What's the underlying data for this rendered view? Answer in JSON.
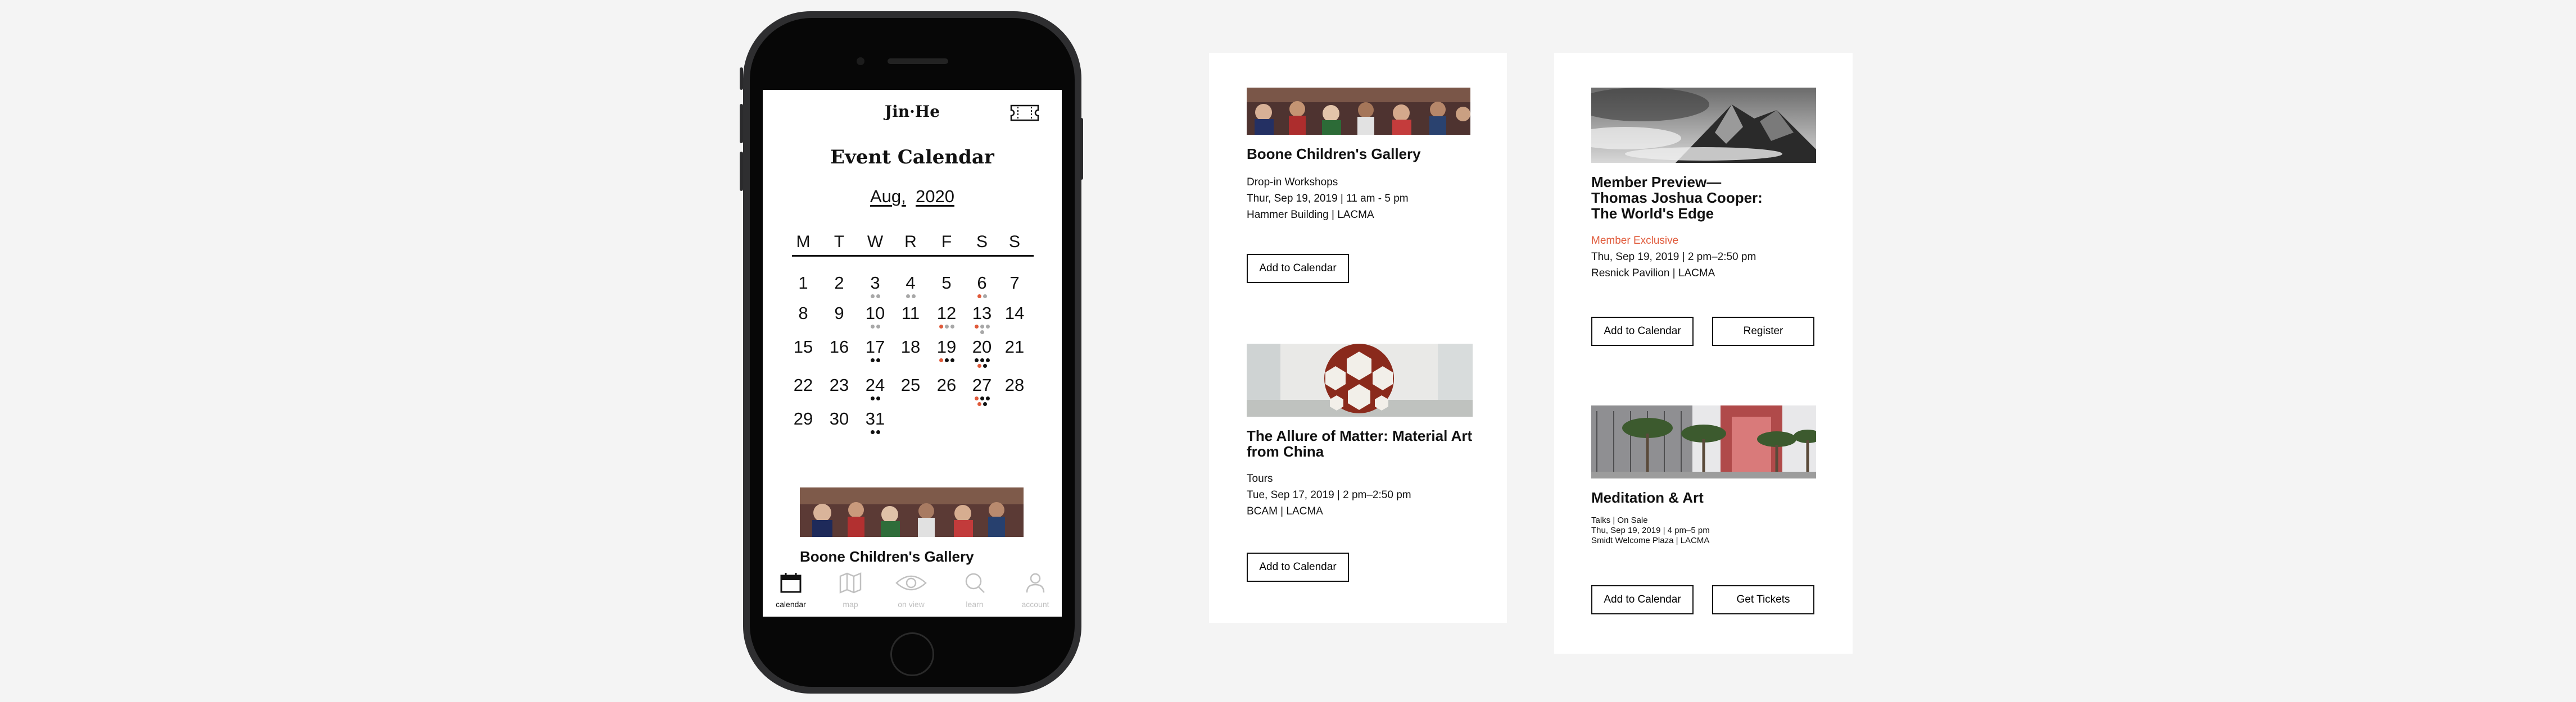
{
  "app": {
    "brand": "Jin·He",
    "title": "Event Calendar",
    "month": "Aug,",
    "year": "2020"
  },
  "weekdays": [
    "M",
    "T",
    "W",
    "R",
    "F",
    "S",
    "S"
  ],
  "colors": {
    "accent": "#e05a3a",
    "dot_gray": "#a8a8a8",
    "dot_black": "#111111"
  },
  "calendar_days": [
    {
      "d": "1",
      "dots": []
    },
    {
      "d": "2",
      "dots": []
    },
    {
      "d": "3",
      "dots": [
        "g",
        "g"
      ]
    },
    {
      "d": "4",
      "dots": [
        "g",
        "g"
      ]
    },
    {
      "d": "5",
      "dots": []
    },
    {
      "d": "6",
      "dots": [
        "r",
        "g"
      ]
    },
    {
      "d": "7",
      "dots": []
    },
    {
      "d": "8",
      "dots": []
    },
    {
      "d": "9",
      "dots": []
    },
    {
      "d": "10",
      "dots": [
        "g",
        "g"
      ]
    },
    {
      "d": "11",
      "dots": []
    },
    {
      "d": "12",
      "dots": [
        "r",
        "g",
        "g"
      ]
    },
    {
      "d": "13",
      "dots": [
        "r",
        "g",
        "g",
        "g"
      ]
    },
    {
      "d": "14",
      "dots": []
    },
    {
      "d": "15",
      "dots": []
    },
    {
      "d": "16",
      "dots": []
    },
    {
      "d": "17",
      "dots": [
        "k",
        "k"
      ]
    },
    {
      "d": "18",
      "dots": []
    },
    {
      "d": "19",
      "dots": [
        "r",
        "k",
        "k"
      ]
    },
    {
      "d": "20",
      "dots": [
        "k",
        "k",
        "k",
        "r",
        "k"
      ]
    },
    {
      "d": "21",
      "dots": []
    },
    {
      "d": "22",
      "dots": []
    },
    {
      "d": "23",
      "dots": []
    },
    {
      "d": "24",
      "dots": [
        "k",
        "k"
      ]
    },
    {
      "d": "25",
      "dots": []
    },
    {
      "d": "26",
      "dots": []
    },
    {
      "d": "27",
      "dots": [
        "r",
        "k",
        "k",
        "r",
        "k"
      ]
    },
    {
      "d": "28",
      "dots": []
    },
    {
      "d": "29",
      "dots": []
    },
    {
      "d": "30",
      "dots": []
    },
    {
      "d": "31",
      "dots": [
        "k",
        "k"
      ]
    }
  ],
  "screen_event": {
    "title": "Boone Children's Gallery"
  },
  "tabs": [
    {
      "label": "calendar",
      "icon": "calendar-icon",
      "active": true
    },
    {
      "label": "map",
      "icon": "map-icon",
      "active": false
    },
    {
      "label": "on view",
      "icon": "eye-icon",
      "active": false
    },
    {
      "label": "learn",
      "icon": "search-icon",
      "active": false
    },
    {
      "label": "account",
      "icon": "person-icon",
      "active": false
    }
  ],
  "events": [
    {
      "title": "Boone Children's Gallery",
      "category": "Drop-in Workshops",
      "date": "Thur, Sep 19, 2019 | 11 am - 5 pm",
      "location": "Hammer Building  |  LACMA",
      "buttons": [
        "Add to Calendar"
      ]
    },
    {
      "title": "The Allure of Matter: Material Art from China",
      "category": "Tours",
      "date": "Tue, Sep 17, 2019 | 2 pm–2:50 pm",
      "location": "BCAM  |  LACMA",
      "buttons": [
        "Add to Calendar"
      ]
    },
    {
      "title": "Member Preview— Thomas Joshua Cooper: The World's Edge",
      "category": "Member Exclusive",
      "date": "Thu, Sep 19, 2019 | 2 pm–2:50 pm",
      "location": "Resnick Pavilion  |  LACMA",
      "buttons": [
        "Add to Calendar",
        "Register"
      ]
    },
    {
      "title": "Meditation & Art",
      "category": "Talks  |  On Sale",
      "date": "Thu, Sep 19, 2019 | 4 pm–5 pm",
      "location": "Smidt Welcome Plaza  |  LACMA",
      "buttons": [
        "Add to Calendar",
        "Get Tickets"
      ]
    }
  ]
}
